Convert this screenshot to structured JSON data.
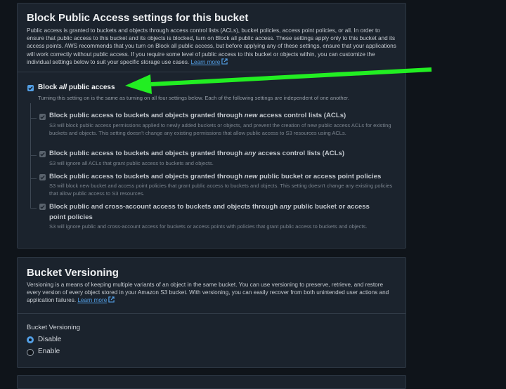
{
  "block_public_access": {
    "title": "Block Public Access settings for this bucket",
    "description": "Public access is granted to buckets and objects through access control lists (ACLs), bucket policies, access point policies, or all. In order to ensure that public access to this bucket and its objects is blocked, turn on Block all public access. These settings apply only to this bucket and its access points. AWS recommends that you turn on Block all public access, but before applying any of these settings, ensure that your applications will work correctly without public access. If you require some level of public access to this bucket or objects within, you can customize the individual settings below to suit your specific storage use cases.",
    "learn_more": "Learn more",
    "block_all": {
      "label_prefix": "Block ",
      "label_em": "all",
      "label_suffix": " public access",
      "checked": true,
      "description": "Turning this setting on is the same as turning on all four settings below. Each of the following settings are independent of one another."
    },
    "options": [
      {
        "label_pre": "Block public access to buckets and objects granted through ",
        "label_em": "new",
        "label_post": " access control lists (ACLs)",
        "description": "S3 will block public access permissions applied to newly added buckets or objects, and prevent the creation of new public access ACLs for existing buckets and objects. This setting doesn't change any existing permissions that allow public access to S3 resources using ACLs.",
        "checked": true
      },
      {
        "label_pre": "Block public access to buckets and objects granted through ",
        "label_em": "any",
        "label_post": " access control lists (ACLs)",
        "description": "S3 will ignore all ACLs that grant public access to buckets and objects.",
        "checked": true
      },
      {
        "label_pre": "Block public access to buckets and objects granted through ",
        "label_em": "new",
        "label_post": " public bucket or access point policies",
        "description": "S3 will block new bucket and access point policies that grant public access to buckets and objects. This setting doesn't change any existing policies that allow public access to S3 resources.",
        "checked": true
      },
      {
        "label_pre": "Block public and cross-account access to buckets and objects through ",
        "label_em": "any",
        "label_post": " public bucket or access point policies",
        "description": "S3 will ignore public and cross-account access for buckets or access points with policies that grant public access to buckets and objects.",
        "checked": true
      }
    ]
  },
  "bucket_versioning": {
    "title": "Bucket Versioning",
    "description": "Versioning is a means of keeping multiple variants of an object in the same bucket. You can use versioning to preserve, retrieve, and restore every version of every object stored in your Amazon S3 bucket. With versioning, you can easily recover from both unintended user actions and application failures.",
    "learn_more": "Learn more",
    "field_label": "Bucket Versioning",
    "options": [
      {
        "label": "Disable",
        "selected": true
      },
      {
        "label": "Enable",
        "selected": false
      }
    ]
  },
  "colors": {
    "accent": "#539fe5",
    "annotation_arrow": "#22ee22",
    "panel": "#1b232d",
    "background": "#0f141a"
  },
  "icons": [
    "external-link-icon",
    "checkmark-icon",
    "arrow-annotation"
  ]
}
